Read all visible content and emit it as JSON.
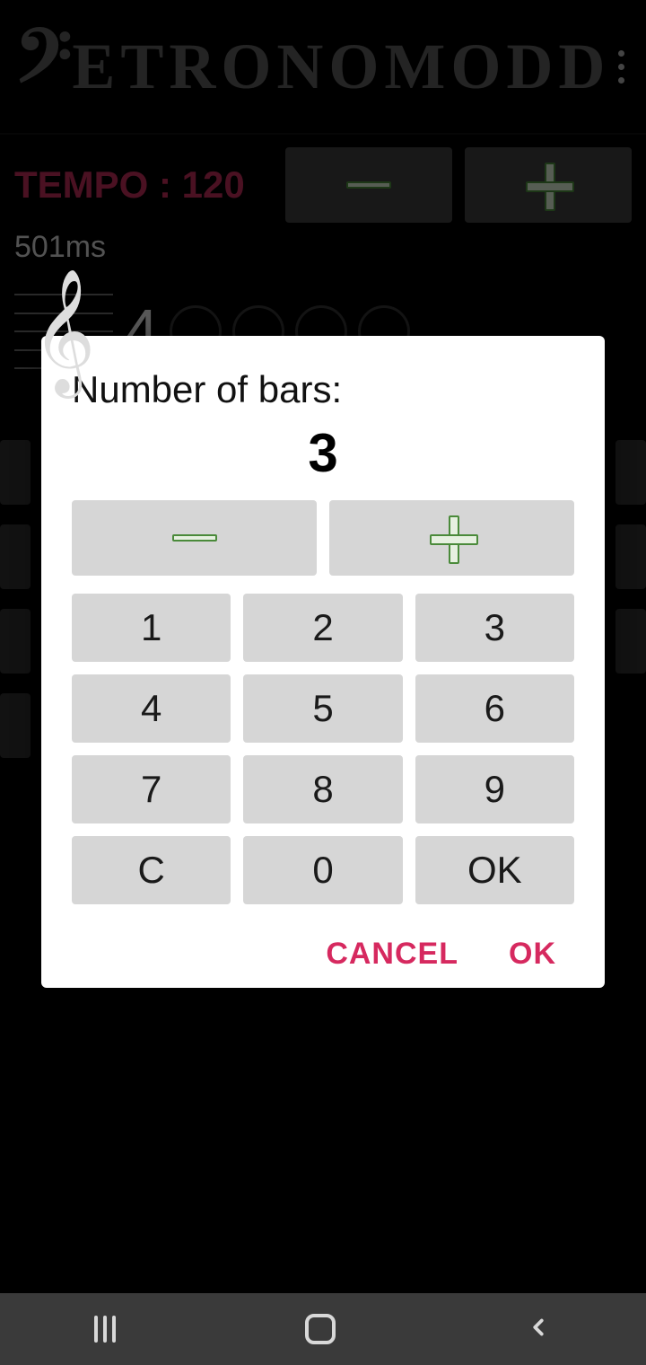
{
  "app": {
    "title": "ETRONOMODD"
  },
  "tempo": {
    "label": "TEMPO : ",
    "value": "120",
    "ms": "501ms"
  },
  "staff": {
    "beats": "4"
  },
  "dialog": {
    "title": "Number of bars:",
    "value": "3",
    "keys": [
      "1",
      "2",
      "3",
      "4",
      "5",
      "6",
      "7",
      "8",
      "9",
      "C",
      "0",
      "OK"
    ],
    "cancel": "CANCEL",
    "ok": "OK"
  }
}
